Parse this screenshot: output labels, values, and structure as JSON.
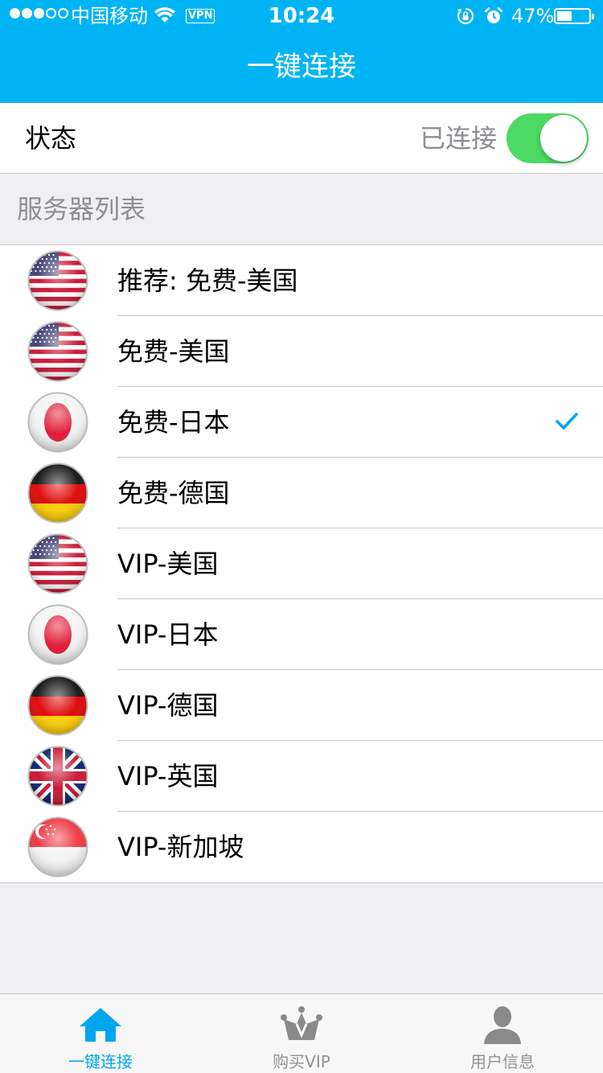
{
  "status_bar": {
    "carrier": "中国移动",
    "vpn_label": "VPN",
    "time": "10:24",
    "battery_percent": "47%",
    "battery_level": 0.47
  },
  "nav": {
    "title": "一键连接"
  },
  "status": {
    "label": "状态",
    "value": "已连接",
    "toggle_on": true
  },
  "section": {
    "title": "服务器列表"
  },
  "servers": [
    {
      "name": "推荐: 免费-美国",
      "flag": "us-flag-icon",
      "selected": false
    },
    {
      "name": "免费-美国",
      "flag": "us-flag-icon",
      "selected": false
    },
    {
      "name": "免费-日本",
      "flag": "jp-flag-icon",
      "selected": true
    },
    {
      "name": "免费-德国",
      "flag": "de-flag-icon",
      "selected": false
    },
    {
      "name": "VIP-美国",
      "flag": "us-flag-icon",
      "selected": false
    },
    {
      "name": "VIP-日本",
      "flag": "jp-flag-icon",
      "selected": false
    },
    {
      "name": "VIP-德国",
      "flag": "de-flag-icon",
      "selected": false
    },
    {
      "name": "VIP-英国",
      "flag": "uk-flag-icon",
      "selected": false
    },
    {
      "name": "VIP-新加坡",
      "flag": "sg-flag-icon",
      "selected": false
    }
  ],
  "tabs": [
    {
      "label": "一键连接",
      "icon": "home-icon",
      "active": true
    },
    {
      "label": "购买VIP",
      "icon": "crown-icon",
      "active": false
    },
    {
      "label": "用户信息",
      "icon": "user-icon",
      "active": false
    }
  ],
  "colors": {
    "accent": "#00b4f4",
    "toggle_on": "#4cd964",
    "tab_active": "#00a6f0",
    "tab_inactive": "#929292"
  }
}
